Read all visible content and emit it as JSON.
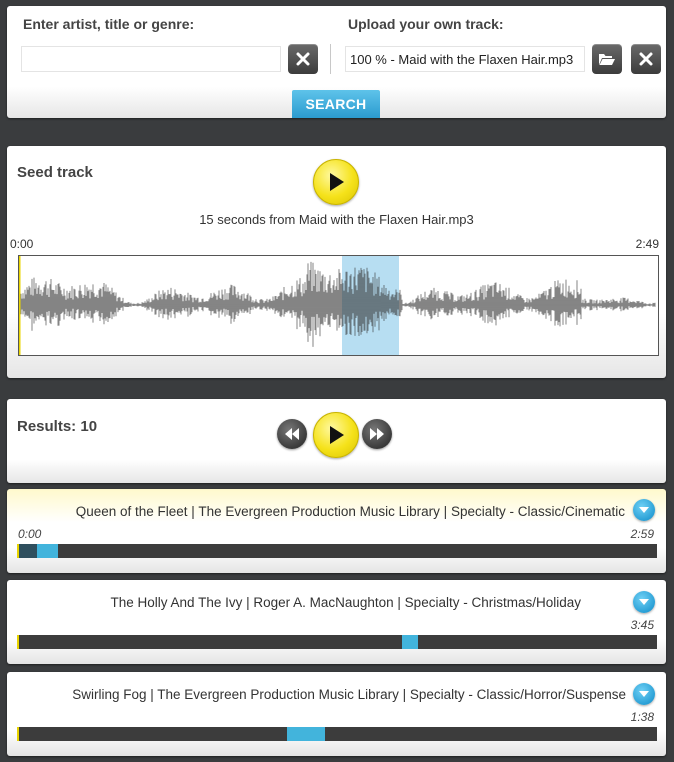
{
  "search": {
    "label": "Enter artist, title or genre:",
    "input_value": "",
    "button_label": "SEARCH"
  },
  "upload": {
    "label": "Upload your own track:",
    "file_value": "100 % - Maid with the Flaxen Hair.mp3"
  },
  "seed": {
    "title": "Seed track",
    "caption": "15 seconds from Maid with the Flaxen Hair.mp3",
    "time_start": "0:00",
    "time_end": "2:49",
    "selection_start_fraction": 0.505,
    "selection_end_fraction": 0.595
  },
  "results": {
    "label": "Results:",
    "count": "10",
    "tracks": [
      {
        "title": "Queen of the Fleet | The Evergreen Production Music Library | Specialty - Classic/Cinematic",
        "time_start": "0:00",
        "duration": "2:59",
        "active": true,
        "played_fraction": 0.032,
        "segment_start_fraction": 0.032,
        "segment_end_fraction": 0.064
      },
      {
        "title": "The Holly And The Ivy | Roger A. MacNaughton | Specialty - Christmas/Holiday",
        "time_start": "",
        "duration": "3:45",
        "active": false,
        "played_fraction": 0,
        "segment_start_fraction": 0.602,
        "segment_end_fraction": 0.627
      },
      {
        "title": "Swirling Fog | The Evergreen Production Music Library | Specialty - Classic/Horror/Suspense",
        "time_start": "",
        "duration": "1:38",
        "active": false,
        "played_fraction": 0,
        "segment_start_fraction": 0.422,
        "segment_end_fraction": 0.481
      }
    ]
  },
  "icons": {
    "clear": "close-icon",
    "folder": "folder-open-icon",
    "play": "play-icon",
    "previous": "rewind-icon",
    "next": "fast-forward-icon",
    "expand": "chevron-down-icon"
  },
  "colors": {
    "accent_blue": "#42b4dc",
    "play_yellow": "#f5e21a",
    "waveform_selection": "#b7def2"
  }
}
